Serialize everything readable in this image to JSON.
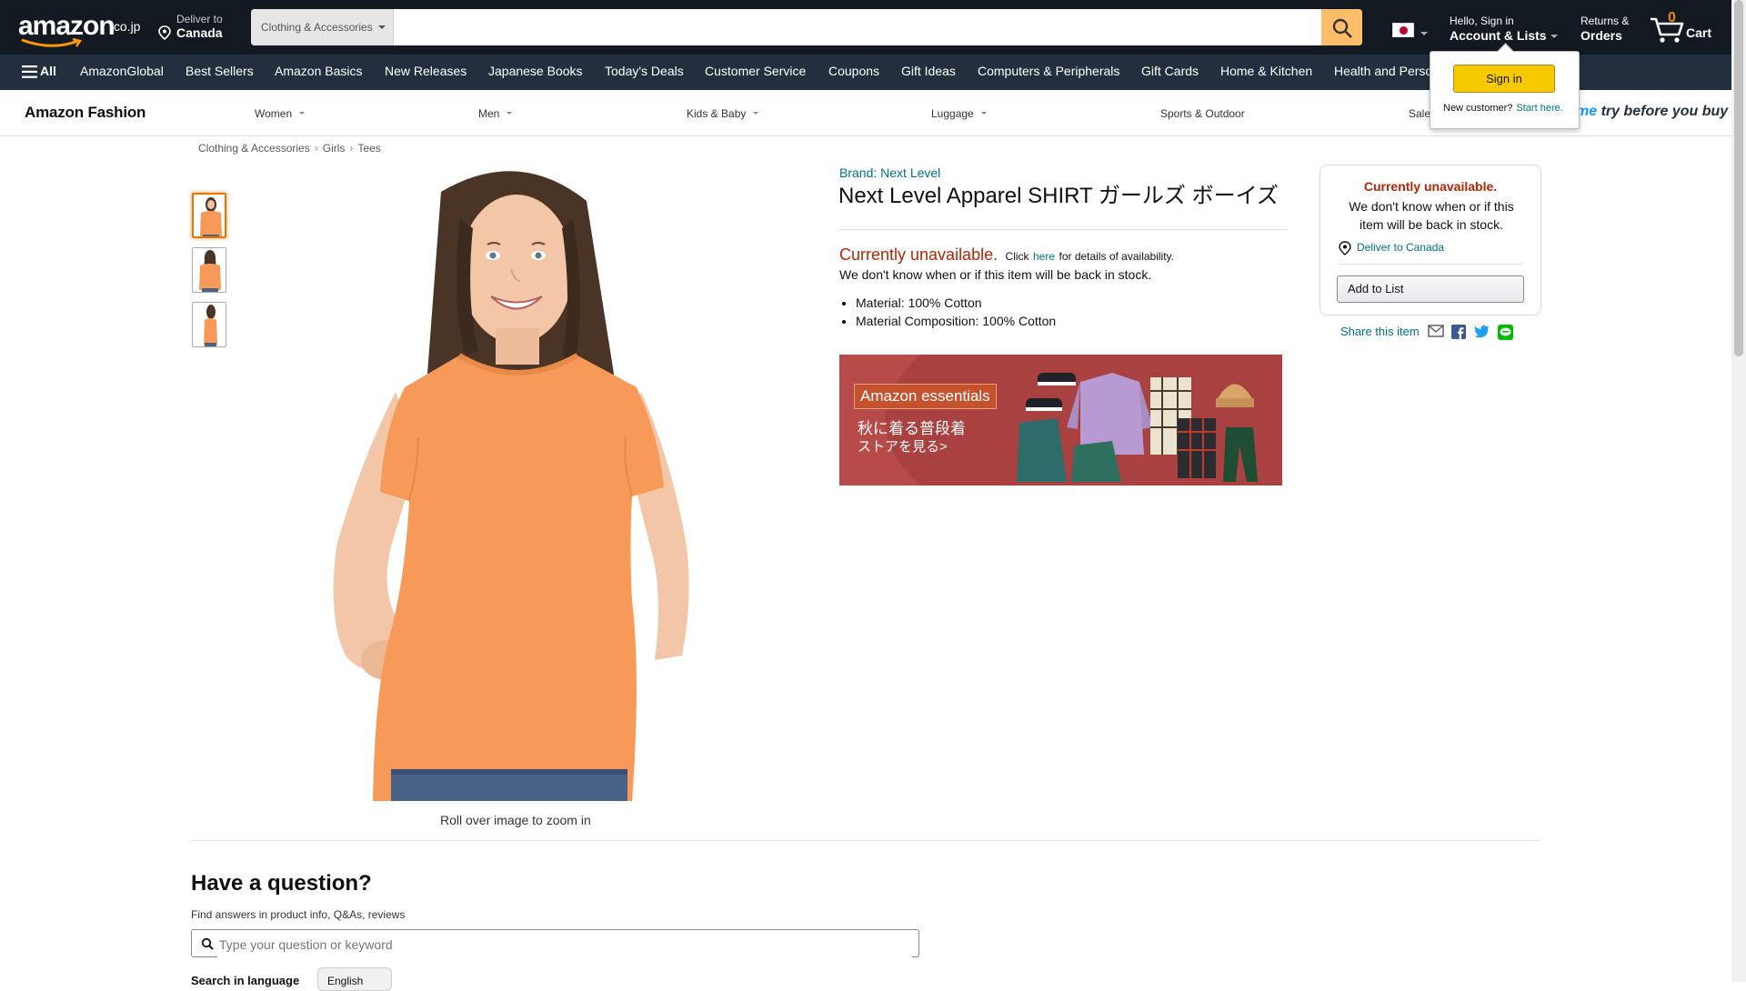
{
  "header": {
    "logo_tld": ".co.jp",
    "deliver_line1": "Deliver to",
    "deliver_line2": "Canada",
    "search_category": "Clothing & Accessories",
    "search_placeholder": "",
    "account_line1": "Hello, Sign in",
    "account_line2": "Account & Lists",
    "returns_line1": "Returns &",
    "returns_line2": "Orders",
    "cart_count": "0",
    "cart_label": "Cart",
    "search_button_color": "#febd69"
  },
  "nav": {
    "all_label": "All",
    "items": [
      "AmazonGlobal",
      "Best Sellers",
      "Amazon Basics",
      "New Releases",
      "Japanese Books",
      "Today's Deals",
      "Customer Service",
      "Coupons",
      "Gift Ideas",
      "Computers & Peripherals",
      "Gift Cards",
      "Home & Kitchen",
      "Health and Perso"
    ]
  },
  "fashion": {
    "brand": "Amazon Fashion",
    "items": [
      "Women",
      "Men",
      "Kids & Baby",
      "Luggage",
      "Sports & Outdoor",
      "Sale"
    ],
    "prime_p": "me",
    "prime_text": " try before you buy"
  },
  "signin_popover": {
    "button": "Sign in",
    "new_customer": "New customer?",
    "start_here": "Start here."
  },
  "breadcrumb": [
    "Clothing & Accessories",
    "Girls",
    "Tees"
  ],
  "images": {
    "rollover": "Roll over image to zoom in",
    "thumb_count": 3,
    "selected_thumb": 0
  },
  "product": {
    "brand_link": "Brand: Next Level",
    "title": "Next Level Apparel SHIRT ガールズ ボーイズ",
    "unavailable": "Currently unavailable.",
    "click": "Click",
    "here": "here",
    "details": "for details of availability.",
    "back_in_stock": "We don't know when or if this item will be back in stock.",
    "bullets": [
      "Material: 100% Cotton",
      "Material Composition: 100% Cotton"
    ]
  },
  "banner": {
    "tag": "Amazon essentials",
    "line1": "秋に着る普段着",
    "line2": "ストアを見る>"
  },
  "buybox": {
    "unavailable": "Currently unavailable.",
    "message": "We don't know when or if this item will be back in stock.",
    "deliver": "Deliver to Canada",
    "add_to_list": "Add to List",
    "share_label": "Share this item"
  },
  "qa": {
    "title": "Have a question?",
    "subtitle": "Find answers in product info, Q&As, reviews",
    "placeholder": "Type your question or keyword",
    "language_label": "Search in language",
    "language_value": "English"
  },
  "colors": {
    "topbar": "#131921",
    "navbar": "#232f3e",
    "accent_orange": "#f08804",
    "link": "#007185",
    "unavailable_red": "#b12704",
    "shirt_orange": "#f79a59"
  }
}
